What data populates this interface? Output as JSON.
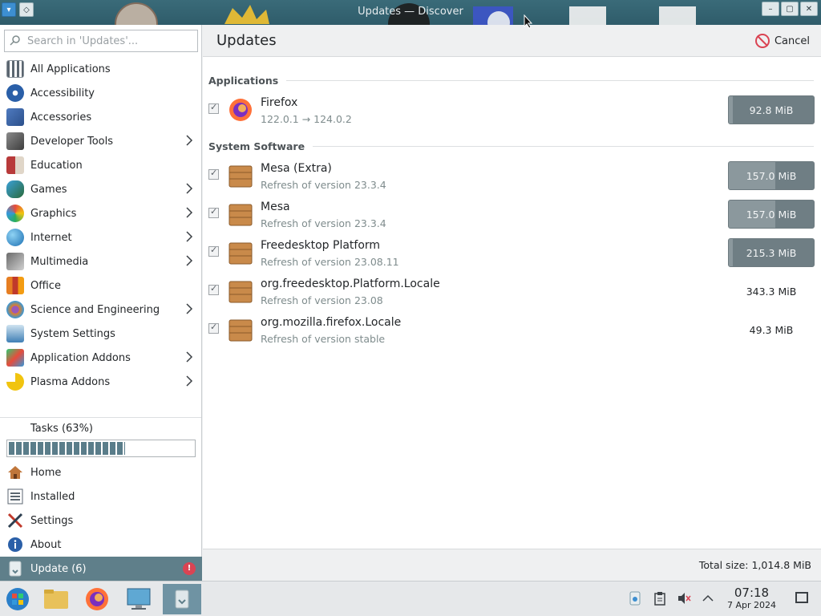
{
  "window": {
    "title": "Updates — Discover"
  },
  "sidebar": {
    "search_placeholder": "Search in 'Updates'...",
    "categories": [
      {
        "label": "All Applications",
        "icon": "grid-icon",
        "has_submenu": false
      },
      {
        "label": "Accessibility",
        "icon": "accessibility-icon",
        "has_submenu": false
      },
      {
        "label": "Accessories",
        "icon": "accessories-icon",
        "has_submenu": false
      },
      {
        "label": "Developer Tools",
        "icon": "developer-tools-icon",
        "has_submenu": true
      },
      {
        "label": "Education",
        "icon": "education-icon",
        "has_submenu": false
      },
      {
        "label": "Games",
        "icon": "games-icon",
        "has_submenu": true
      },
      {
        "label": "Graphics",
        "icon": "graphics-icon",
        "has_submenu": true
      },
      {
        "label": "Internet",
        "icon": "internet-icon",
        "has_submenu": true
      },
      {
        "label": "Multimedia",
        "icon": "multimedia-icon",
        "has_submenu": true
      },
      {
        "label": "Office",
        "icon": "office-icon",
        "has_submenu": false
      },
      {
        "label": "Science and Engineering",
        "icon": "science-icon",
        "has_submenu": true
      },
      {
        "label": "System Settings",
        "icon": "system-settings-icon",
        "has_submenu": false
      },
      {
        "label": "Application Addons",
        "icon": "addons-icon",
        "has_submenu": true
      },
      {
        "label": "Plasma Addons",
        "icon": "plasma-addons-icon",
        "has_submenu": true
      }
    ],
    "tasks_label": "Tasks (63%)",
    "tasks_progress": 0.63,
    "nav": [
      {
        "label": "Home",
        "icon": "home-icon"
      },
      {
        "label": "Installed",
        "icon": "installed-icon"
      },
      {
        "label": "Settings",
        "icon": "settings-icon"
      },
      {
        "label": "About",
        "icon": "about-icon"
      }
    ],
    "update_label": "Update (6)",
    "update_badge": "!"
  },
  "main": {
    "title": "Updates",
    "cancel_label": "Cancel",
    "sections": [
      {
        "title": "Applications"
      },
      {
        "title": "System Software"
      }
    ],
    "updates": [
      {
        "name": "Firefox",
        "subtitle": "122.0.1 → 124.0.2",
        "size": "92.8 MiB",
        "icon": "firefox-icon",
        "downloading": true,
        "progress": 0.05
      },
      {
        "name": "Mesa (Extra)",
        "subtitle": "Refresh of version 23.3.4",
        "size": "157.0 MiB",
        "icon": "package-icon",
        "downloading": true,
        "progress": 0.55
      },
      {
        "name": "Mesa",
        "subtitle": "Refresh of version 23.3.4",
        "size": "157.0 MiB",
        "icon": "package-icon",
        "downloading": true,
        "progress": 0.55
      },
      {
        "name": "Freedesktop Platform",
        "subtitle": "Refresh of version 23.08.11",
        "size": "215.3 MiB",
        "icon": "package-icon",
        "downloading": true,
        "progress": 0.05
      },
      {
        "name": "org.freedesktop.Platform.Locale",
        "subtitle": "Refresh of version 23.08",
        "size": "343.3 MiB",
        "icon": "package-icon",
        "downloading": false
      },
      {
        "name": "org.mozilla.firefox.Locale",
        "subtitle": "Refresh of version stable",
        "size": "49.3 MiB",
        "icon": "package-icon",
        "downloading": false
      }
    ],
    "total_size": "Total size: 1,014.8 MiB"
  },
  "taskbar": {
    "apps": [
      "start-menu-icon",
      "file-manager-icon",
      "firefox-icon",
      "system-monitor-icon",
      "discover-icon"
    ],
    "clock_time": "07:18",
    "clock_date": "7 Apr 2024"
  },
  "colors": {
    "accent": "#5f7f8a",
    "titlebar": "#2f5c6a",
    "badge": "#da4453",
    "size_button": "#6f7e84"
  }
}
